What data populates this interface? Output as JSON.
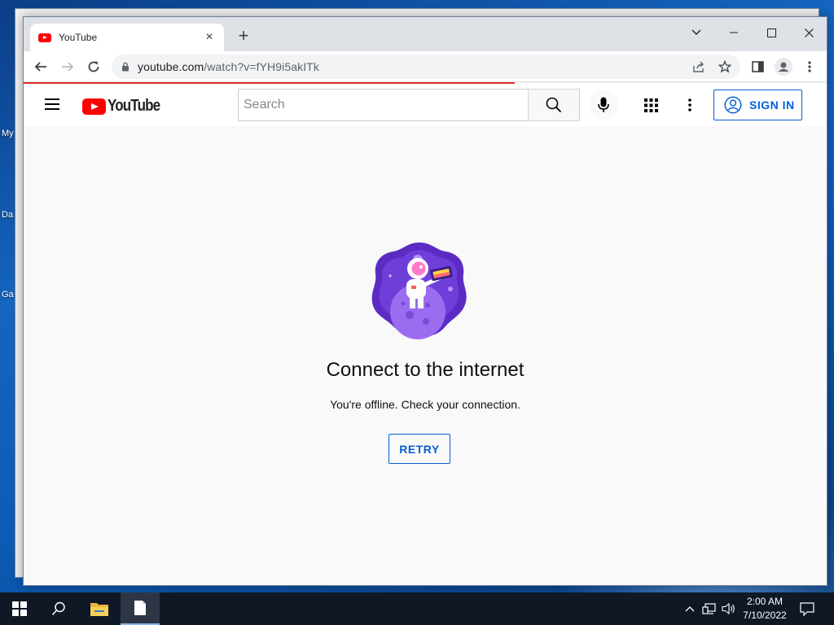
{
  "desktop": {
    "icon_labels": [
      "My",
      "Da",
      "Ga"
    ]
  },
  "browser": {
    "tab": {
      "title": "YouTube",
      "close_glyph": "×",
      "favicon": "youtube-favicon"
    },
    "new_tab_glyph": "+",
    "window_controls": {
      "dropdown": "⌄",
      "minimize": "—",
      "maximize": "☐",
      "close": "✕"
    },
    "address": {
      "url_host": "youtube.com",
      "url_path": "/watch?v=fYH9i5akITk"
    },
    "page_loading_progress": 0.61
  },
  "youtube": {
    "logo_text": "YouTube",
    "search": {
      "placeholder": "Search",
      "value": ""
    },
    "sign_in_label": "SIGN IN",
    "accent_color": "#065fd4",
    "brand_red": "#ff0000"
  },
  "offline": {
    "title": "Connect to the internet",
    "message": "You're offline. Check your connection.",
    "retry_label": "RETRY"
  },
  "taskbar": {
    "time": "2:00 AM",
    "date": "7/10/2022",
    "pinned": [
      "start-icon",
      "search-icon",
      "file-explorer-icon",
      "notepad-icon"
    ]
  }
}
